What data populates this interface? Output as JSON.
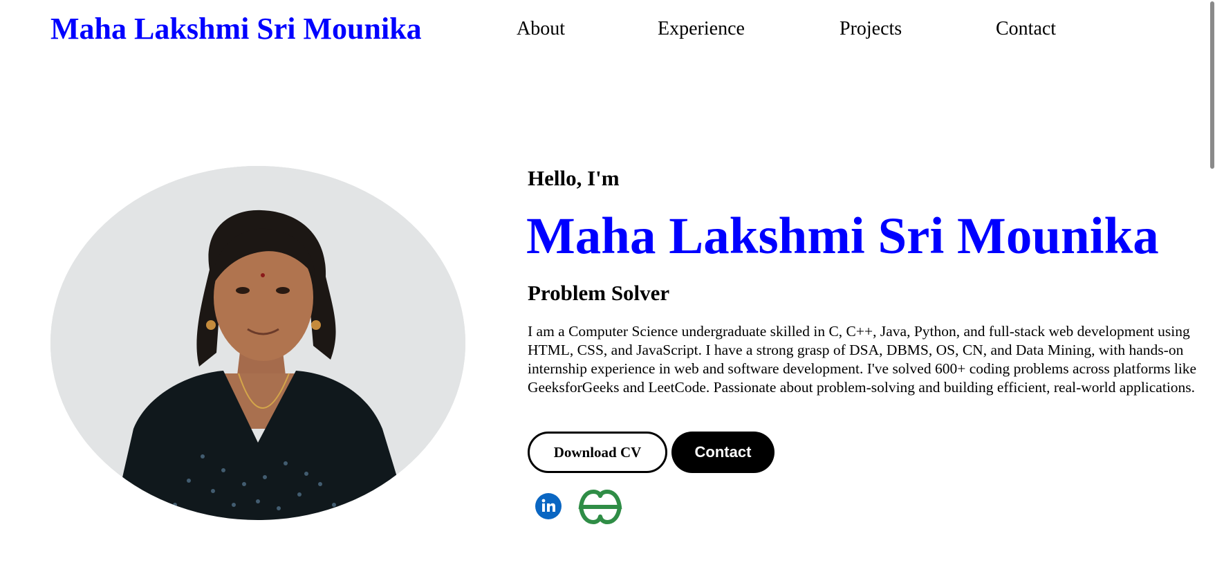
{
  "nav": {
    "brand": "Maha Lakshmi Sri Mounika",
    "links": [
      "About",
      "Experience",
      "Projects",
      "Contact"
    ]
  },
  "hero": {
    "greeting": "Hello, I'm",
    "name": "Maha Lakshmi Sri Mounika",
    "role": "Problem Solver",
    "bio": "I am a Computer Science undergraduate skilled in C, C++, Java, Python, and full-stack web development using HTML, CSS, and JavaScript. I have a strong grasp of DSA, DBMS, OS, CN, and Data Mining, with hands-on internship experience in web and software development. I've solved 600+ coding problems across platforms like GeeksforGeeks and LeetCode. Passionate about problem-solving and building efficient, real-world applications."
  },
  "buttons": {
    "download_cv": "Download CV",
    "contact": "Contact"
  },
  "social": {
    "linkedin_icon": "linkedin-icon",
    "gfg_icon": "geeksforgeeks-icon"
  },
  "colors": {
    "accent": "#0000ff",
    "linkedin": "#0a66c2",
    "gfg": "#2f8d46"
  }
}
